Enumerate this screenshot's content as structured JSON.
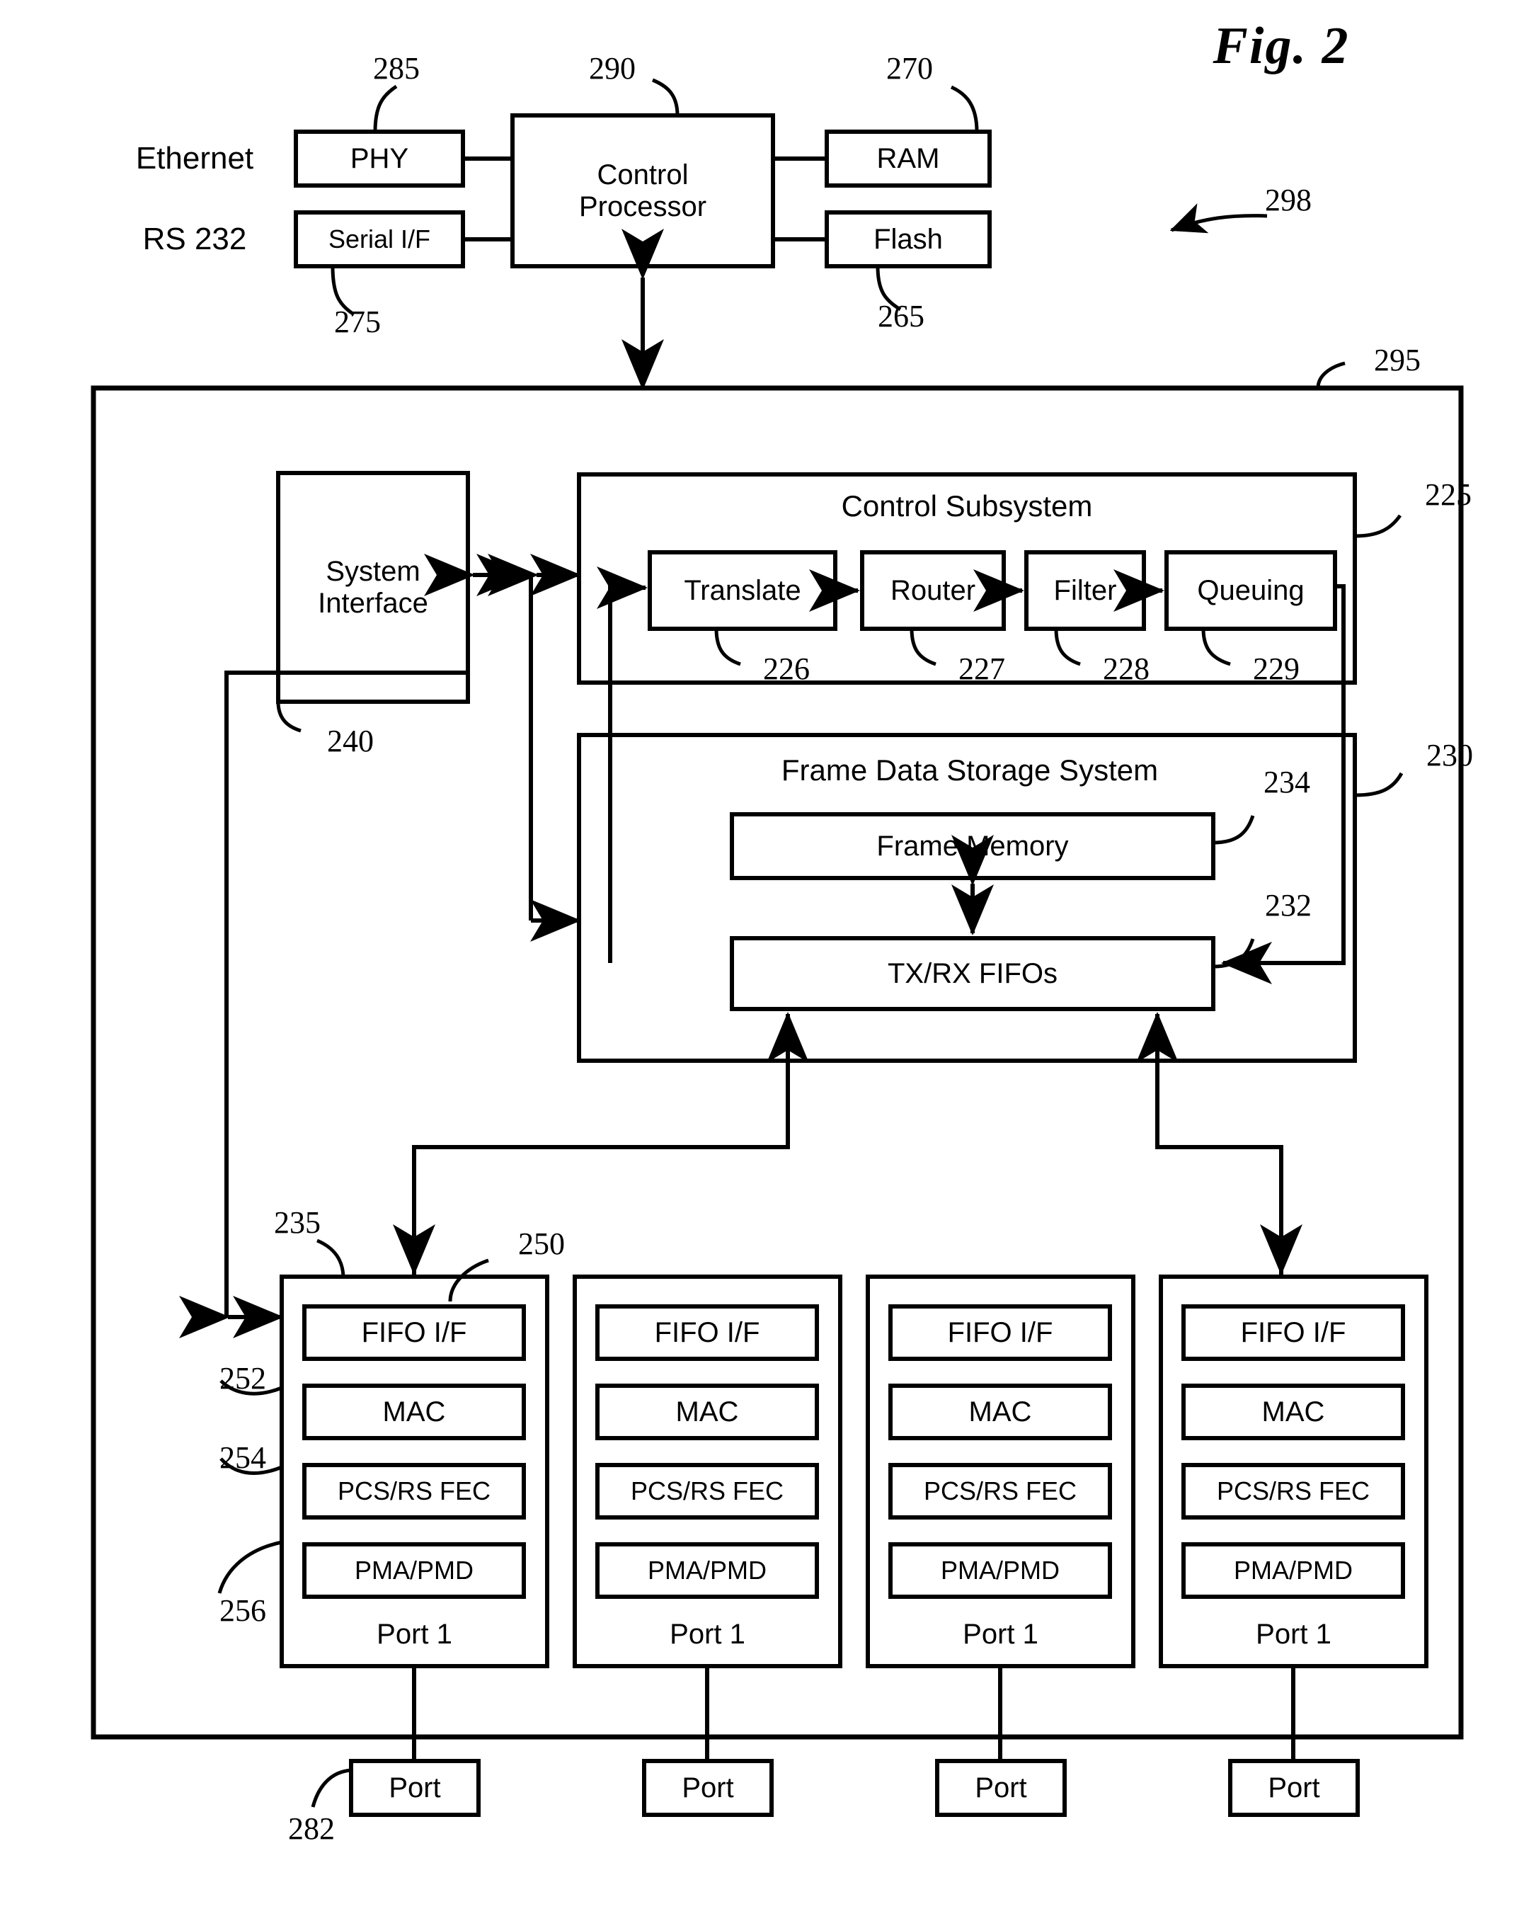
{
  "figure": {
    "title": "Fig. 2",
    "overall_ref": "298"
  },
  "top_section": {
    "left_labels": [
      {
        "text": "Ethernet"
      },
      {
        "text": "RS 232"
      }
    ],
    "boxes": [
      {
        "id": "phy",
        "label": "PHY",
        "ref": "285"
      },
      {
        "id": "serial",
        "label": "Serial I/F",
        "ref": "275"
      },
      {
        "id": "cpu",
        "label": "Control\nProcessor",
        "ref": "290"
      },
      {
        "id": "ram",
        "label": "RAM",
        "ref": "270"
      },
      {
        "id": "flash",
        "label": "Flash",
        "ref": "265"
      }
    ]
  },
  "main_device": {
    "ref": "295",
    "system_interface": {
      "label": "System\nInterface",
      "ref": "240"
    },
    "control_subsystem": {
      "title": "Control Subsystem",
      "ref": "225",
      "stages": [
        {
          "label": "Translate",
          "ref": "226"
        },
        {
          "label": "Router",
          "ref": "227"
        },
        {
          "label": "Filter",
          "ref": "228"
        },
        {
          "label": "Queuing",
          "ref": "229"
        }
      ]
    },
    "frame_storage": {
      "title": "Frame Data Storage System",
      "ref": "230",
      "blocks": [
        {
          "label": "Frame Memory",
          "ref": "234"
        },
        {
          "label": "TX/RX FIFOs",
          "ref": "232"
        }
      ]
    },
    "port_bus_ref": "235",
    "ports": [
      {
        "name": "Port 1",
        "layers": [
          {
            "label": "FIFO I/F",
            "ref": "250"
          },
          {
            "label": "MAC",
            "ref": "252"
          },
          {
            "label": "PCS/RS FEC",
            "ref": "254"
          },
          {
            "label": "PMA/PMD",
            "ref": "256"
          }
        ]
      },
      {
        "name": "Port 1",
        "layers": [
          {
            "label": "FIFO I/F",
            "ref": ""
          },
          {
            "label": "MAC",
            "ref": ""
          },
          {
            "label": "PCS/RS FEC",
            "ref": ""
          },
          {
            "label": "PMA/PMD",
            "ref": ""
          }
        ]
      },
      {
        "name": "Port 1",
        "layers": [
          {
            "label": "FIFO I/F",
            "ref": ""
          },
          {
            "label": "MAC",
            "ref": ""
          },
          {
            "label": "PCS/RS FEC",
            "ref": ""
          },
          {
            "label": "PMA/PMD",
            "ref": ""
          }
        ]
      },
      {
        "name": "Port 1",
        "layers": [
          {
            "label": "FIFO I/F",
            "ref": ""
          },
          {
            "label": "MAC",
            "ref": ""
          },
          {
            "label": "PCS/RS FEC",
            "ref": ""
          },
          {
            "label": "PMA/PMD",
            "ref": ""
          }
        ]
      }
    ]
  },
  "external_ports": {
    "ref": "282",
    "items": [
      {
        "label": "Port"
      },
      {
        "label": "Port"
      },
      {
        "label": "Port"
      },
      {
        "label": "Port"
      }
    ]
  },
  "colors": {
    "line": "#000000",
    "background": "#ffffff"
  }
}
